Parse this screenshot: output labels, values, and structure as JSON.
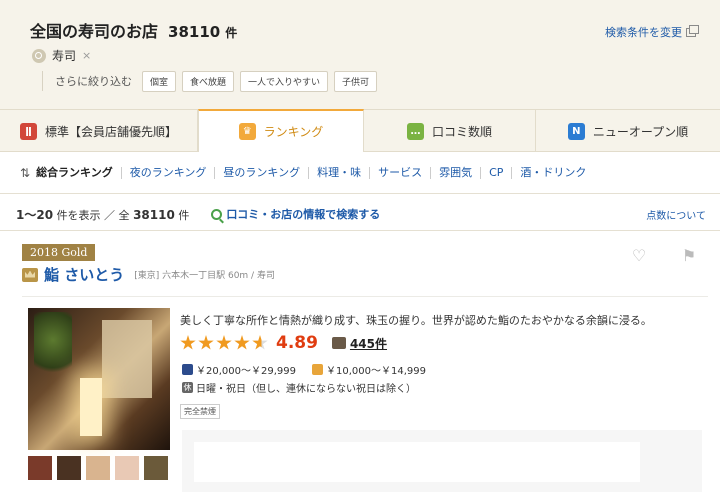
{
  "header": {
    "title": "全国の寿司のお店",
    "count": "38110",
    "count_unit": "件",
    "change_link": "検索条件を変更",
    "keyword": "寿司",
    "keyword_remove": "×",
    "refine_label": "さらに絞り込む",
    "chips": [
      "個室",
      "食べ放題",
      "一人で入りやすい",
      "子供可"
    ]
  },
  "tabs": [
    {
      "label": "標準【会員店舗優先順】",
      "icon": "fork-knife-icon",
      "icon_color": "#d2473a"
    },
    {
      "label": "ランキング",
      "icon": "crown-icon",
      "icon_color": "#f2a93b"
    },
    {
      "label": "口コミ数順",
      "icon": "speech-bubble-icon",
      "icon_color": "#7ab342"
    },
    {
      "label": "ニューオープン順",
      "icon": "n-icon",
      "icon_color": "#2b7cd3",
      "icon_text": "N"
    }
  ],
  "subnav": {
    "items": [
      "総合ランキング",
      "夜のランキング",
      "昼のランキング",
      "料理・味",
      "サービス",
      "雰囲気",
      "CP",
      "酒・ドリンク"
    ]
  },
  "results": {
    "range": "1～20",
    "range_suffix": "件を表示 ／ 全",
    "total": "38110",
    "total_unit": "件",
    "search_link": "口コミ・お店の情報で検索する",
    "points_link": "点数について"
  },
  "restaurant": {
    "award": "2018 Gold",
    "name": "鮨 さいとう",
    "area": "[東京] 六本木一丁目駅 60m / 寿司",
    "catch": "美しく丁寧な所作と情熱が織り成す、珠玉の握り。世界が認めた鮨のたおやかなる余韻に浸る。",
    "stars": 4.5,
    "score": "4.89",
    "reviews": "445件",
    "dinner_price": "￥20,000～￥29,999",
    "lunch_price": "￥10,000～￥14,999",
    "closed": "日曜・祝日（但し、連休にならない祝日は除く）",
    "smoking": "完全禁煙",
    "thumb_colors": [
      "#7a3a2a",
      "#4a3222",
      "#d9b48f",
      "#e9c9b5",
      "#6b5a3a"
    ]
  }
}
